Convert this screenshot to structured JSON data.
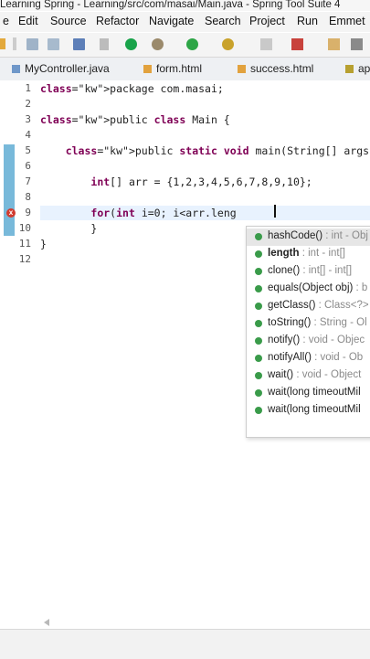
{
  "window": {
    "title": "Learning Spring - Learning/src/com/masai/Main.java - Spring Tool Suite 4"
  },
  "menu": [
    "e",
    "Edit",
    "Source",
    "Refactor",
    "Navigate",
    "Search",
    "Project",
    "Run",
    "Emmet"
  ],
  "tabs": [
    {
      "label": "MyController.java",
      "icon": "java-file-icon"
    },
    {
      "label": "form.html",
      "icon": "html-file-icon"
    },
    {
      "label": "success.html",
      "icon": "html-file-icon"
    },
    {
      "label": "ap",
      "icon": "file-icon"
    }
  ],
  "editor": {
    "line_numbers": [
      "1",
      "2",
      "3",
      "4",
      "5",
      "6",
      "7",
      "8",
      "9",
      "10",
      "11",
      "12"
    ],
    "lines": [
      "package com.masai;",
      "",
      "public class Main {",
      "",
      "    public static void main(String[] args) {",
      "",
      "        int[] arr = {1,2,3,4,5,6,7,8,9,10};",
      "",
      "        for(int i=0; i<arr.leng",
      "        }",
      "}",
      ""
    ]
  },
  "autocomplete": {
    "items": [
      {
        "name": "hashCode()",
        "ret": " : int - Obj"
      },
      {
        "name": "length",
        "ret": " : int - int[]"
      },
      {
        "name": "clone()",
        "ret": " : int[] - int[]"
      },
      {
        "name": "equals(Object obj)",
        "ret": " : b"
      },
      {
        "name": "getClass()",
        "ret": " : Class<?>"
      },
      {
        "name": "toString()",
        "ret": " : String - Ol"
      },
      {
        "name": "notify()",
        "ret": " : void - Objec"
      },
      {
        "name": "notifyAll()",
        "ret": " : void - Ob"
      },
      {
        "name": "wait()",
        "ret": " : void - Object"
      },
      {
        "name": "wait(long timeoutMil",
        "ret": ""
      },
      {
        "name": "wait(long timeoutMil",
        "ret": ""
      }
    ]
  }
}
